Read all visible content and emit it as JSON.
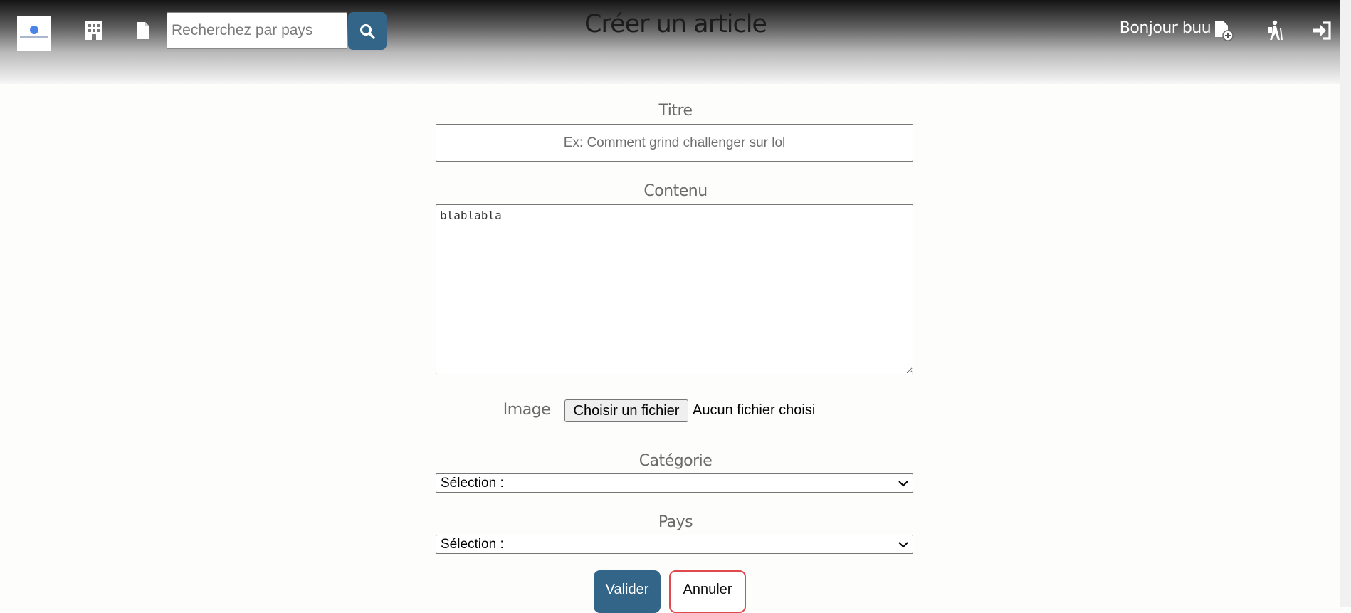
{
  "header": {
    "search": {
      "placeholder": "Recherchez par pays",
      "value": ""
    },
    "title": "Créer un article",
    "greeting": "Bonjour buu !",
    "icons": [
      "logo",
      "building-icon",
      "file-icon",
      "search-icon",
      "file-add-icon",
      "hiking-icon",
      "sign-in-icon"
    ]
  },
  "form": {
    "titre": {
      "label": "Titre",
      "placeholder": "Ex: Comment grind challenger sur lol",
      "value": ""
    },
    "contenu": {
      "label": "Contenu",
      "value": "blablabla"
    },
    "image": {
      "label": "Image",
      "button": "Choisir un fichier",
      "status": "Aucun fichier choisi"
    },
    "categorie": {
      "label": "Catégorie",
      "selected": "Sélection :"
    },
    "pays": {
      "label": "Pays",
      "selected": "Sélection :"
    },
    "submit_label": "Valider",
    "cancel_label": "Annuler"
  },
  "colors": {
    "primary": "#336589",
    "cancel_border": "#e2494d",
    "background": "#fdfdfc"
  }
}
